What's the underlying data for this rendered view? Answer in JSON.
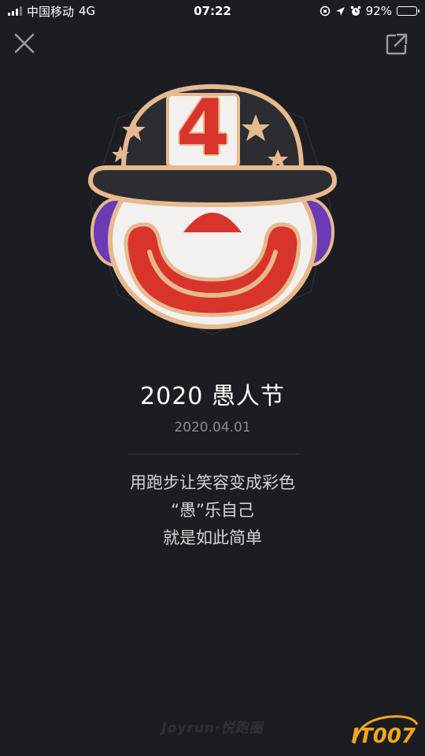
{
  "status_bar": {
    "carrier": "中国移动",
    "network": "4G",
    "time": "07:22",
    "battery": "92%",
    "battery_level": 0.92,
    "icons": [
      "signal-icon",
      "orientation-lock-icon",
      "location-arrow-icon",
      "alarm-icon",
      "battery-icon"
    ]
  },
  "top_bar": {
    "icons": [
      "close-icon",
      "share-icon"
    ]
  },
  "badge": {
    "number": "4",
    "icon": "clown-badge-icon",
    "colors": {
      "gold": "#e7b98f",
      "hat": "#2b2d33",
      "red": "#d9342b",
      "purple": "#6a3bb4",
      "white": "#f2f1ef"
    }
  },
  "content": {
    "title": "2020 愚人节",
    "date": "2020.04.01",
    "desc_lines": [
      "用跑步让笑容变成彩色",
      "“愚”乐自己",
      "就是如此简单"
    ]
  },
  "brand": "Joyrun·悦跑圈",
  "watermark": "IT007"
}
